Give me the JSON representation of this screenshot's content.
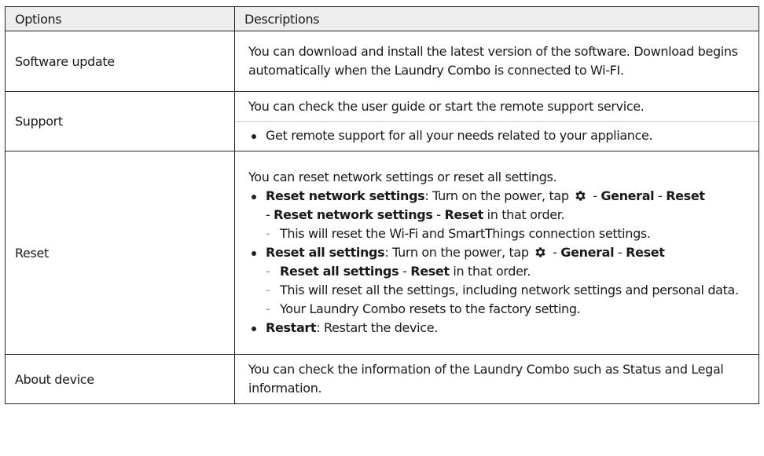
{
  "table": {
    "headers": [
      "Options",
      "Descriptions"
    ],
    "rows": {
      "software_update": {
        "option": "Software update",
        "desc": "You can download and install the latest version of the software. Download begins automatically when the Laundry Combo is connected to Wi-FI."
      },
      "support": {
        "option": "Support",
        "intro": "You can check the user guide or start the remote support service.",
        "bullet": "Get remote support for all your needs related to your appliance."
      },
      "reset": {
        "option": "Reset",
        "intro": "You can reset network settings or reset all settings.",
        "network_title": "Reset network settings",
        "network_text": ": Turn on the power, tap",
        "general": "General",
        "reset": "Reset",
        "sep": " - ",
        "in_that_order": " in that order.",
        "network_note": "This will reset the Wi-Fi and SmartThings connection settings.",
        "all_title": "Reset all settings",
        "all_note1": "This will reset all the settings, including network settings and personal data.",
        "all_note2": "Your Laundry Combo resets to the factory setting.",
        "restart_title": "Restart",
        "restart_text": ": Restart the device."
      },
      "about": {
        "option": "About device",
        "desc": "You can check the information of the Laundry Combo such as Status and Legal information."
      }
    }
  },
  "icons": {
    "settings": "gear-icon"
  }
}
